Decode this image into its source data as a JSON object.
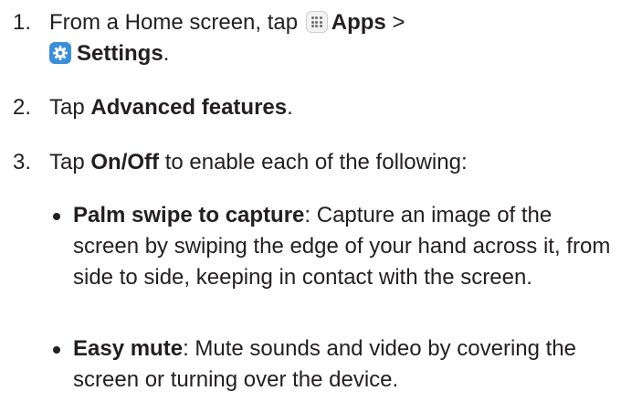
{
  "steps": [
    {
      "number": "1.",
      "parts": {
        "t1": "From a Home screen, tap",
        "apps": "Apps",
        "sep": ">",
        "settings": "Settings",
        "end": "."
      }
    },
    {
      "number": "2.",
      "parts": {
        "t1": "Tap",
        "b1": "Advanced features",
        "end": "."
      }
    },
    {
      "number": "3.",
      "parts": {
        "t1": "Tap",
        "b1": "On/Off",
        "t2": "to enable each of the following:"
      }
    }
  ],
  "bullets": [
    {
      "term": "Palm swipe to capture",
      "desc": ": Capture an image of the screen by swiping the edge of your hand across it, from side to side, keeping in contact with the screen."
    },
    {
      "term": "Easy mute",
      "desc": ": Mute sounds and video by covering the screen or turning over the device."
    }
  ],
  "icons": {
    "apps_icon": "apps-grid-icon",
    "settings_icon": "gear-icon",
    "settings_color": "#3a8fd8"
  }
}
